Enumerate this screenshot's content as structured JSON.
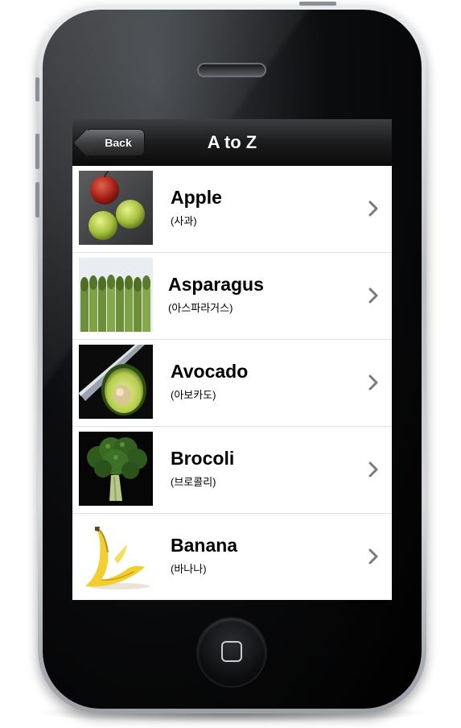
{
  "nav": {
    "back_label": "Back",
    "title": "A to Z"
  },
  "items": [
    {
      "name": "Apple",
      "korean": "(사과)",
      "image": "apples-photo"
    },
    {
      "name": "Asparagus",
      "korean": "(아스파라거스)",
      "image": "asparagus-photo"
    },
    {
      "name": "Avocado",
      "korean": "(아보카도)",
      "image": "avocado-photo"
    },
    {
      "name": "Brocoli",
      "korean": "(브로콜리)",
      "image": "broccoli-photo"
    },
    {
      "name": "Banana",
      "korean": "(바나나)",
      "image": "banana-photo"
    }
  ],
  "icons": {
    "chevron": "chevron-right-icon",
    "home": "home-button-icon"
  },
  "colors": {
    "navbar": "#1b1c1e",
    "chevron": "#7a7a7a"
  }
}
